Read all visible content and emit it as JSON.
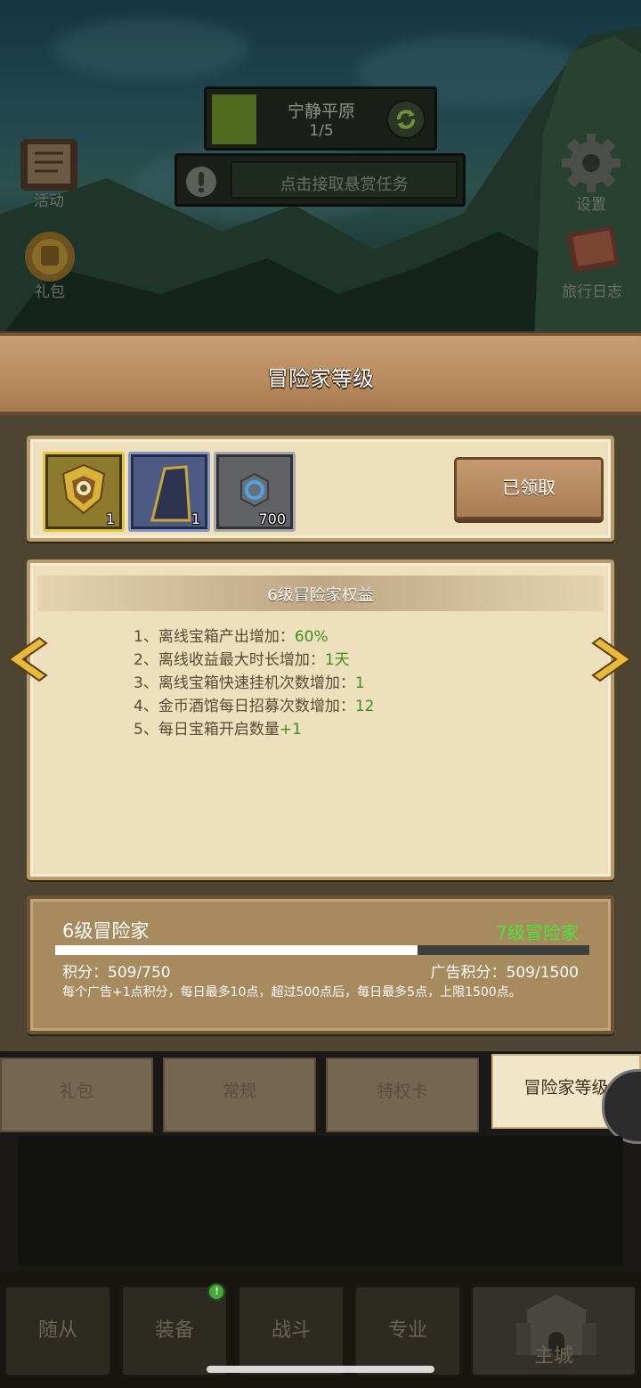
{
  "top": {
    "stage_title": "宁静平原",
    "stage_progress": "1/5",
    "bounty_text": "点击接取悬赏任务"
  },
  "side_buttons": {
    "activity": "活动",
    "gift": "礼包",
    "settings": "设置",
    "journal": "旅行日志"
  },
  "panel": {
    "title": "冒险家等级",
    "rewards": [
      {
        "icon": "golden-armor-icon",
        "qty": "1"
      },
      {
        "icon": "cloak-icon",
        "qty": "1"
      },
      {
        "icon": "gem-icon",
        "qty": "700"
      }
    ],
    "claimed_label": "已领取",
    "benefits_title": "6级冒险家权益",
    "benefits": [
      {
        "text": "1、离线宝箱产出增加：",
        "value": "60%"
      },
      {
        "text": "2、离线收益最大时长增加：",
        "value": "1天"
      },
      {
        "text": "3、离线宝箱快速挂机次数增加：",
        "value": "1"
      },
      {
        "text": "4、金币酒馆每日招募次数增加：",
        "value": "12"
      },
      {
        "text": "5、每日宝箱开启数量",
        "value": "+1"
      }
    ],
    "level": {
      "current": "6级冒险家",
      "next": "7级冒险家",
      "progress": 0.679,
      "points": "积分：509/750",
      "ad_points": "广告积分：509/1500",
      "note": "每个广告+1点积分，每日最多10点，超过500点后，每日最多5点，上限1500点。"
    }
  },
  "tabs": [
    "礼包",
    "常规",
    "特权卡",
    "冒险家等级"
  ],
  "bottom_nav": [
    "随从",
    "装备",
    "战斗",
    "专业",
    "主城"
  ],
  "nav_badge": "!",
  "colors": {
    "accent_green": "#3c8f1f",
    "next_level_green": "#4be53a",
    "parchment": "#efe0bd"
  }
}
